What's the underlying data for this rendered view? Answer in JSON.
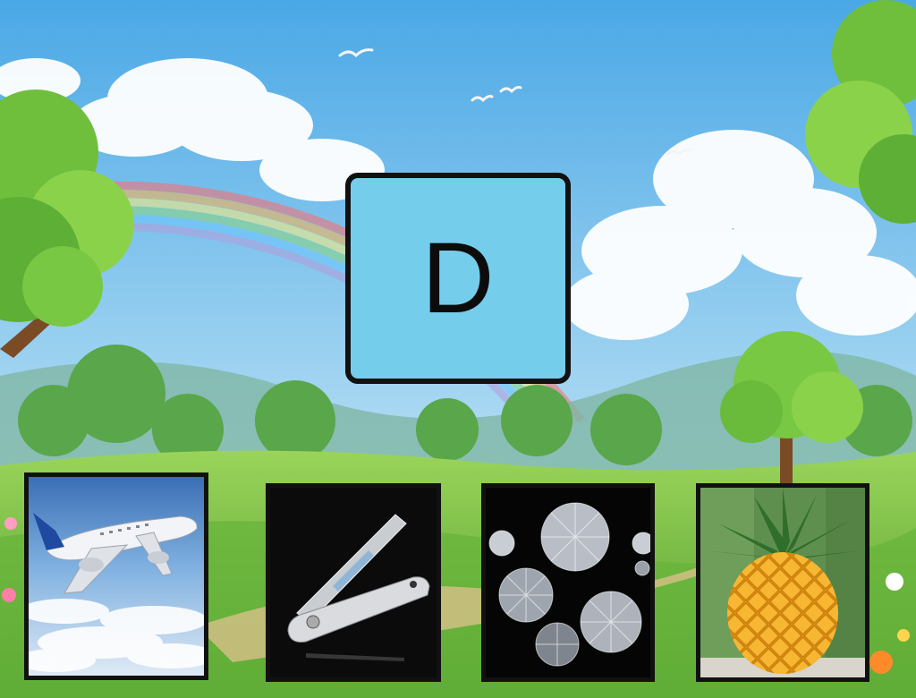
{
  "letter": "D",
  "colors": {
    "sky_top": "#4aa8e6",
    "sky_bottom": "#bfe3f5",
    "grass": "#7cc94a",
    "card_fill": "#75cdec",
    "card_border": "#111111"
  },
  "pictures": [
    {
      "icon": "airplane-icon",
      "subject": "airplane"
    },
    {
      "icon": "nail-clipper-icon",
      "subject": "nail clipper"
    },
    {
      "icon": "diamonds-icon",
      "subject": "diamonds"
    },
    {
      "icon": "pineapple-icon",
      "subject": "pineapple"
    }
  ]
}
